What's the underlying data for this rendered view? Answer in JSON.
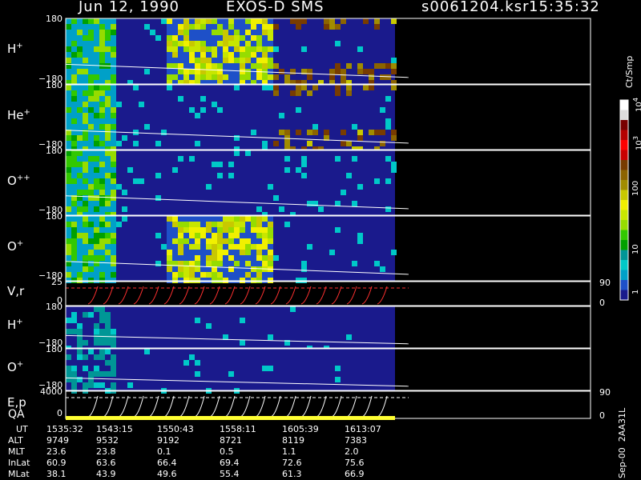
{
  "header": {
    "date": "Jun 12, 1990",
    "instrument": "EXOS-D SMS",
    "file": "s0061204.ksr",
    "time": "15:35:32"
  },
  "panels": [
    {
      "label": "H",
      "sup": "+",
      "ymax": "180",
      "ymin": "−180"
    },
    {
      "label": "He",
      "sup": "+",
      "ymax": "180",
      "ymin": "−180"
    },
    {
      "label": "O",
      "sup": "++",
      "ymax": "180",
      "ymin": "−180"
    },
    {
      "label": "O",
      "sup": "+",
      "ymax": "180",
      "ymin": "−180"
    },
    {
      "label": "V,r",
      "sup": "",
      "ymax": "25",
      "ymin": "0",
      "rmax": "90",
      "rmin": "0"
    },
    {
      "label": "H",
      "sup": "+",
      "ymax": "180",
      "ymin": "−180"
    },
    {
      "label": "O",
      "sup": "+",
      "ymax": "180",
      "ymin": "−180"
    },
    {
      "label": "E,p",
      "sup": "",
      "ymax": "4000",
      "ymin": "0",
      "rmax": "90",
      "rmin": "0"
    }
  ],
  "qa_label": "QA",
  "colorbar": {
    "unit": "Ct/Smp",
    "ticks": [
      "1",
      "10",
      "100",
      "10",
      "10"
    ],
    "tick_sups": [
      "",
      "",
      "",
      "3",
      "4"
    ],
    "colors": [
      "#1a1a8c",
      "#1e50c8",
      "#00a0c8",
      "#00c8c8",
      "#009696",
      "#00a000",
      "#32c800",
      "#96dc00",
      "#c8e600",
      "#f0f000",
      "#c8c800",
      "#a08c00",
      "#8c6400",
      "#783c00",
      "#c80000",
      "#ff0000",
      "#b40000",
      "#780000",
      "#dcdcdc",
      "#ffffff"
    ]
  },
  "footer": {
    "rows": [
      {
        "label": "UT",
        "values": [
          "1535:32",
          "1543:15",
          "1550:43",
          "1558:11",
          "1605:39",
          "1613:07"
        ]
      },
      {
        "label": "ALT",
        "values": [
          "9749",
          "9532",
          "9192",
          "8721",
          "8119",
          "7383"
        ]
      },
      {
        "label": "MLT",
        "values": [
          "23.6",
          "23.8",
          "0.1",
          "0.5",
          "1.1",
          "2.0"
        ]
      },
      {
        "label": "InLat",
        "values": [
          "60.9",
          "63.6",
          "66.4",
          "69.4",
          "72.6",
          "75.6"
        ]
      },
      {
        "label": "MLat",
        "values": [
          "38.1",
          "43.9",
          "49.6",
          "55.4",
          "61.3",
          "66.9"
        ]
      }
    ],
    "side": "Sep-00  2AA31L"
  },
  "chart_data": {
    "type": "heatmap",
    "title": "Jun 12, 1990   EXOS-D SMS",
    "x_ticks": [
      "1535:32",
      "1543:15",
      "1550:43",
      "1558:11",
      "1605:39",
      "1613:07"
    ],
    "panels": [
      "H+",
      "He+",
      "O++",
      "O+",
      "V,r",
      "H+",
      "O+",
      "E,p"
    ],
    "colorbar_label": "Ct/Smp",
    "colorbar_range": [
      1,
      10000
    ],
    "colorbar_scale": "log",
    "data_end_fraction": 0.64
  }
}
